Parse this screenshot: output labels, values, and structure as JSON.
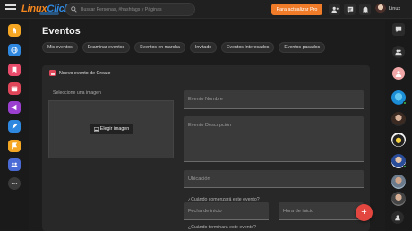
{
  "topbar": {
    "logo_part1": "Linux",
    "logo_part2": "Click",
    "search_placeholder": "Buscar Personas, #hashtags y Páginas",
    "pro_button": "Para actualizar Pro",
    "user_name": "Linux",
    "icons": [
      "add-user-icon",
      "messages-icon",
      "notifications-icon"
    ]
  },
  "left_rail": {
    "items": [
      {
        "icon": "home-icon",
        "color": "#f5a623"
      },
      {
        "icon": "globe-icon",
        "color": "#2f88e0"
      },
      {
        "icon": "ticket-icon",
        "color": "#e94b6b"
      },
      {
        "icon": "calendar-icon",
        "color": "#e0465a"
      },
      {
        "icon": "megaphone-icon",
        "color": "#9b3fd1"
      },
      {
        "icon": "blog-icon",
        "color": "#2f88e0"
      },
      {
        "icon": "flag-icon",
        "color": "#f5a623"
      },
      {
        "icon": "groups-icon",
        "color": "#4a6bd6"
      },
      {
        "icon": "more-icon",
        "color": "#3a3a3a"
      }
    ]
  },
  "main": {
    "title": "Eventos",
    "tabs": [
      "Mis eventos",
      "Examinar eventos",
      "Eventos en marcha",
      "Invitado",
      "Eventos Interesados",
      "Eventos pasados"
    ],
    "form": {
      "header": "Nuevo evento de Create",
      "image_label": "Seleccione una imagen",
      "image_button": "Elegir imagen",
      "name_placeholder": "Evento Nombre",
      "description_placeholder": "Evento Descripción",
      "location_placeholder": "Ubicación",
      "start_question": "¿Cuándo comenzará este evento?",
      "start_date_placeholder": "Fecha de inicio",
      "start_time_placeholder": "Hora de inicio",
      "end_question": "¿Cuándo terminará este evento?"
    },
    "fab_label": "+"
  },
  "colors": {
    "accent": "#f07c2a",
    "fab": "#e2463f",
    "online": "#3ec14e"
  }
}
